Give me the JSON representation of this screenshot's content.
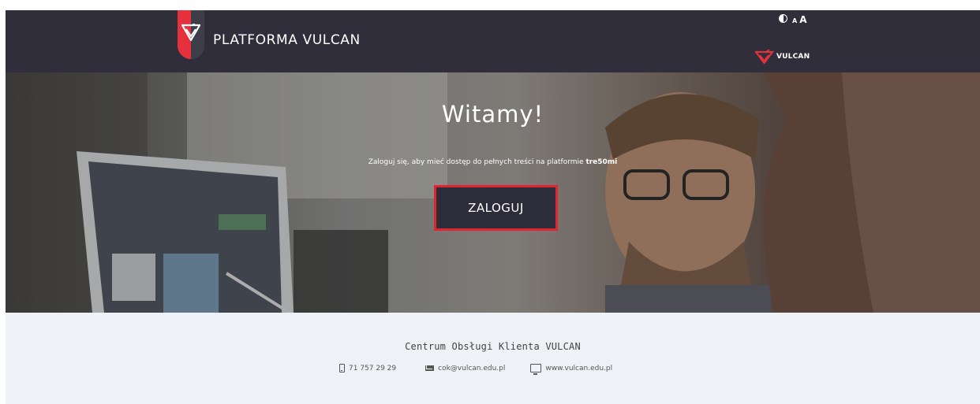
{
  "header": {
    "brand_name": "PLATFORMA VULCAN",
    "accessibility": {
      "contrast_icon": "contrast-icon",
      "font_small_label": "A",
      "font_large_label": "A"
    },
    "partner_logo_text": "VULCAN"
  },
  "hero": {
    "title": "Witamy!",
    "subtitle_prefix": "Zaloguj się, aby mieć dostęp do pełnych treści na platformie ",
    "subtitle_platform": "tre50mi",
    "login_button_label": "ZALOGUJ"
  },
  "footer": {
    "title": "Centrum Obsługi Klienta VULCAN",
    "contacts": [
      {
        "icon": "phone-icon",
        "text": "71 757 29 29"
      },
      {
        "icon": "envelope-icon",
        "text": "cok@vulcan.edu.pl"
      },
      {
        "icon": "monitor-icon",
        "text": "www.vulcan.edu.pl"
      }
    ]
  },
  "colors": {
    "header_bg": "#2f2e3a",
    "brand_red": "#e5313b",
    "button_bg": "#2d2c3a",
    "button_border": "#e3232f",
    "footer_bg": "#eef1f5"
  }
}
